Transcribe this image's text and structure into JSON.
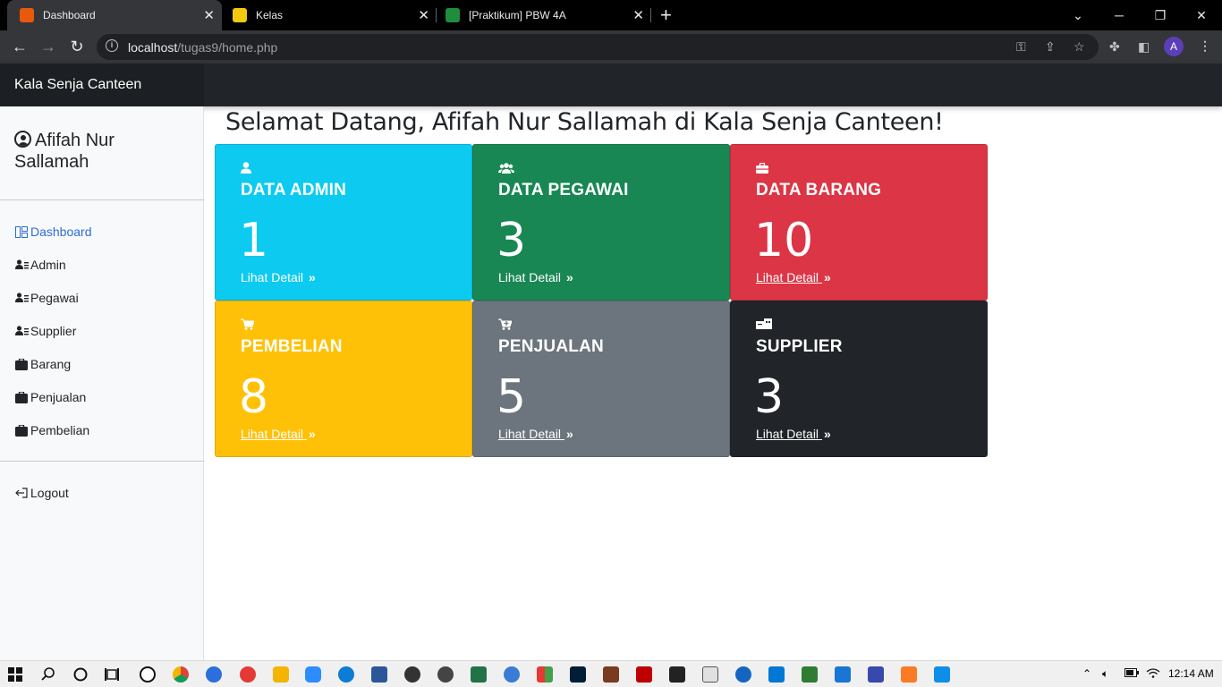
{
  "browser": {
    "tabs": [
      {
        "title": "Dashboard",
        "favicon_color": "#e8590c"
      },
      {
        "title": "Kelas",
        "favicon_color": "#f2c811"
      },
      {
        "title": "[Praktikum] PBW 4A",
        "favicon_color": "#1e8e3e"
      }
    ],
    "url_host": "localhost",
    "url_path": "/tugas9/home.php",
    "profile_initial": "A"
  },
  "app": {
    "brand": "Kala Senja Canteen",
    "user_name": "Afifah Nur Sallamah",
    "welcome": "Selamat Datang, Afifah Nur Sallamah di Kala Senja Canteen!"
  },
  "sidebar": {
    "items": [
      {
        "label": "Dashboard",
        "icon": "layout-icon",
        "active": true
      },
      {
        "label": "Admin",
        "icon": "users-list-icon"
      },
      {
        "label": "Pegawai",
        "icon": "users-list-icon"
      },
      {
        "label": "Supplier",
        "icon": "users-list-icon"
      },
      {
        "label": "Barang",
        "icon": "box-icon"
      },
      {
        "label": "Penjualan",
        "icon": "box-icon"
      },
      {
        "label": "Pembelian",
        "icon": "box-icon"
      }
    ],
    "logout": "Logout"
  },
  "cards": [
    {
      "title": "DATA ADMIN",
      "value": "1",
      "link": "Lihat Detail",
      "color": "#0dcaf0",
      "icon": "user-icon"
    },
    {
      "title": "DATA PEGAWAI",
      "value": "3",
      "link": "Lihat Detail",
      "color": "#198754",
      "icon": "users-icon"
    },
    {
      "title": "DATA BARANG",
      "value": "10",
      "link": "Lihat Detail",
      "color": "#dc3545",
      "icon": "toolbox-icon"
    },
    {
      "title": "PEMBELIAN",
      "value": "8",
      "link": "Lihat Detail",
      "color": "#ffc107",
      "icon": "cart-icon"
    },
    {
      "title": "PENJUALAN",
      "value": "5",
      "link": "Lihat Detail",
      "color": "#6c757d",
      "icon": "cart-plus-icon"
    },
    {
      "title": "SUPPLIER",
      "value": "3",
      "link": "Lihat Detail",
      "color": "#212529",
      "icon": "truck-icon"
    }
  ],
  "taskbar": {
    "time": "12:14 AM"
  }
}
